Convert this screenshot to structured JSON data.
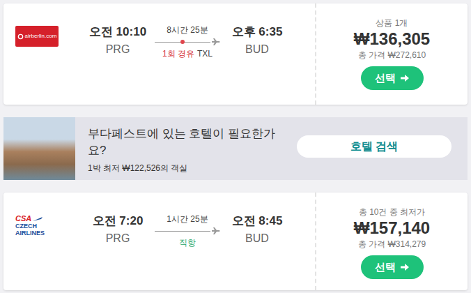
{
  "flights": [
    {
      "logo": {
        "kind": "airberlin",
        "text": "airberlin.com"
      },
      "depart": {
        "time": "오전 10:10",
        "airport": "PRG"
      },
      "duration": "8시간 25분",
      "stops": {
        "text": "1회 경유",
        "via": "TXL",
        "direct": false
      },
      "arrive": {
        "time": "오후 6:35",
        "airport": "BUD"
      },
      "price_label": "상품 1개",
      "price": "₩136,305",
      "total": "총 가격 ₩272,610",
      "button": "선택"
    },
    {
      "logo": {
        "kind": "csa",
        "mark": "CSA",
        "lines": [
          "CZECH",
          "AIRLINES"
        ]
      },
      "depart": {
        "time": "오전 7:20",
        "airport": "PRG"
      },
      "duration": "1시간 25분",
      "stops": {
        "text": "직항",
        "via": "",
        "direct": true
      },
      "arrive": {
        "time": "오전 8:45",
        "airport": "BUD"
      },
      "price_label": "총 10건 중 최저가",
      "price": "₩157,140",
      "total": "총 가격 ₩314,279",
      "button": "선택"
    }
  ],
  "hotel_banner": {
    "question": "부다페스트에 있는 호텔이 필요한가 요?",
    "offer": "1박 최저 ₩122,526의 객실",
    "button": "호텔 검색"
  }
}
